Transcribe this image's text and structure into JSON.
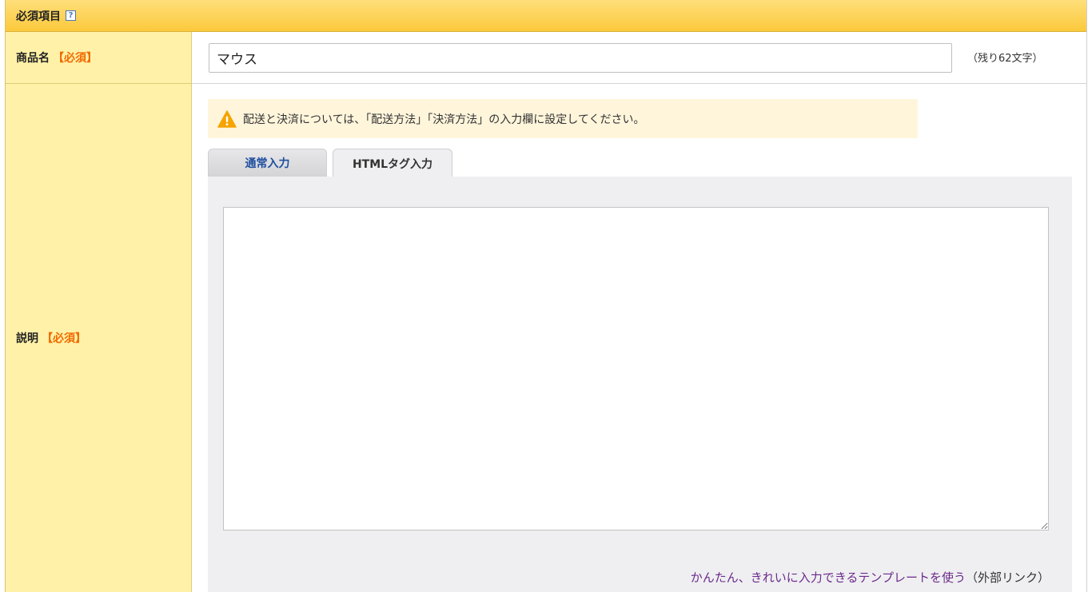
{
  "section": {
    "title": "必須項目",
    "help_icon": "?"
  },
  "product_name": {
    "label": "商品名",
    "required": "【必須】",
    "value": "マウス",
    "remaining": "（残り62文字）"
  },
  "description": {
    "label": "説明",
    "required": "【必須】",
    "notice": "配送と決済については、「配送方法」「決済方法」の入力欄に設定してください。",
    "tabs": [
      {
        "label": "通常入力",
        "active": false
      },
      {
        "label": "HTMLタグ入力",
        "active": true
      }
    ],
    "editor_value": "",
    "template_link": "かんたん、きれいに入力できるテンプレートを使う",
    "external_note": "（外部リンク）"
  },
  "colors": {
    "header": "#fbc93c",
    "label_bg": "#fff2a8",
    "required": "#f26a00",
    "notice_bg": "#fff5db",
    "warning": "#f5a400",
    "tab_link": "#1f4fa0",
    "link": "#6b2a8c"
  },
  "icons": {
    "help": "help-icon",
    "warning": "warning-icon"
  }
}
